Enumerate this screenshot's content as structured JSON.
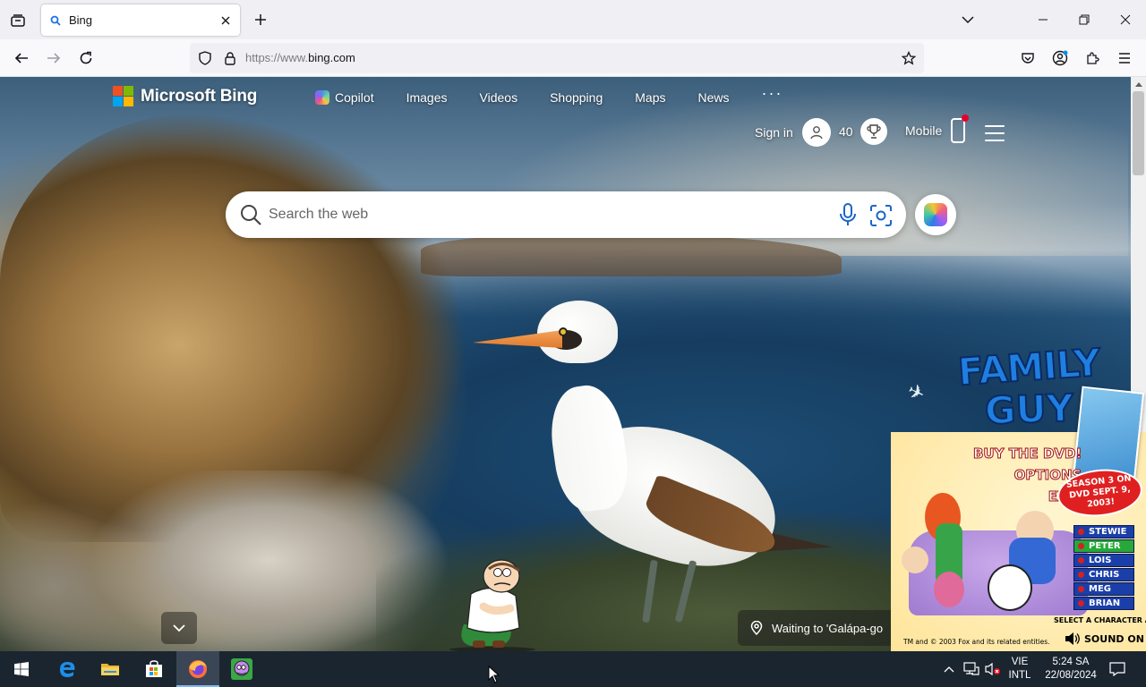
{
  "browser": {
    "tab": {
      "title": "Bing"
    },
    "url": {
      "scheme": "https://www.",
      "host": "bing.com"
    }
  },
  "bing": {
    "brand": "Microsoft Bing",
    "nav": [
      "Copilot",
      "Images",
      "Videos",
      "Shopping",
      "Maps",
      "News"
    ],
    "more": "···",
    "sign_in": "Sign in",
    "points": "40",
    "mobile": "Mobile",
    "search_placeholder": "Search the web",
    "caption": "Waiting to 'Galápa-go"
  },
  "family_guy": {
    "title_line1": "FAMILY",
    "title_line2": "GUY",
    "menu": [
      "BUY THE DVD!",
      "OPTIONS",
      "EXIT"
    ],
    "badge": "SEASON 3 ON DVD SEPT. 9, 2003!",
    "characters": [
      "STEWIE",
      "PETER",
      "LOIS",
      "CHRIS",
      "MEG",
      "BRIAN"
    ],
    "selected": "PETER",
    "select_prompt": "SELECT A CHARACTER ABOVE",
    "copyright": "TM and © 2003 Fox and its related entities.",
    "sound": "SOUND ON"
  },
  "taskbar": {
    "lang_top": "VIE",
    "lang_bottom": "INTL",
    "time": "5:24 SA",
    "date": "22/08/2024"
  },
  "colors": {
    "logo_red": "#f25022",
    "logo_green": "#7fba00",
    "logo_blue": "#00a4ef",
    "logo_yellow": "#ffb900"
  }
}
